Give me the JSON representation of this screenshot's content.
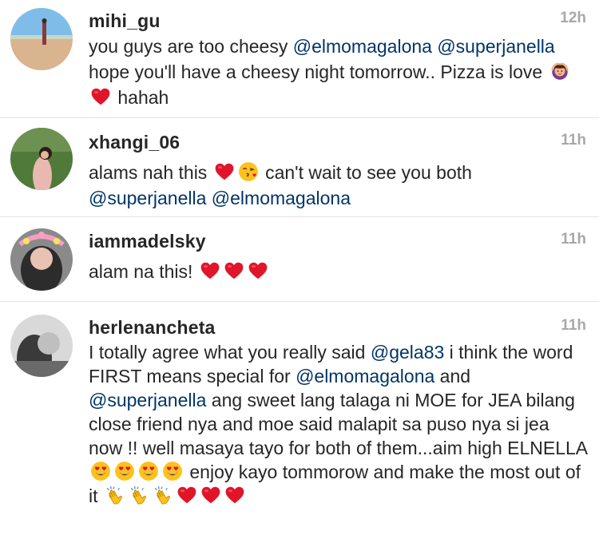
{
  "comments": [
    {
      "username": "mihi_gu",
      "time": "12h",
      "t1": "you guys are too cheesy ",
      "m1": "@elmomagalona",
      "m2": "@superjanella",
      "t2": " hope you'll have a cheesy night tomorrow.. Pizza is love ",
      "t3": " hahah",
      "emoji": [
        "person-gesturing-ok-icon",
        "red-heart-icon"
      ]
    },
    {
      "username": "xhangi_06",
      "time": "11h",
      "t1": "alams nah this ",
      "t2": " can't wait to see you both",
      "m1": "@superjanella",
      "m2": "@elmomagalona",
      "emoji": [
        "red-heart-icon",
        "face-blowing-kiss-icon"
      ]
    },
    {
      "username": "iammadelsky",
      "time": "11h",
      "t1": "alam na this! ",
      "emoji": [
        "red-heart-icon",
        "red-heart-icon",
        "red-heart-icon"
      ]
    },
    {
      "username": "herlenancheta",
      "time": "11h",
      "t1": "I totally agree what you really said ",
      "m1": "@gela83",
      "t2": " i think the word FIRST means special for ",
      "m2": "@elmomagalona",
      "t3": " and ",
      "m3": "@superjanella",
      "t4": " ang sweet lang talaga ni MOE for JEA bilang close friend nya and moe said malapit sa puso nya si jea now !! well masaya tayo for both of them...aim high ELNELLA ",
      "t5": " enjoy kayo tommorow and make the most out of it ",
      "emoji": [
        "heart-eyes-face-icon",
        "clapping-hands-icon",
        "red-heart-icon"
      ]
    }
  ]
}
